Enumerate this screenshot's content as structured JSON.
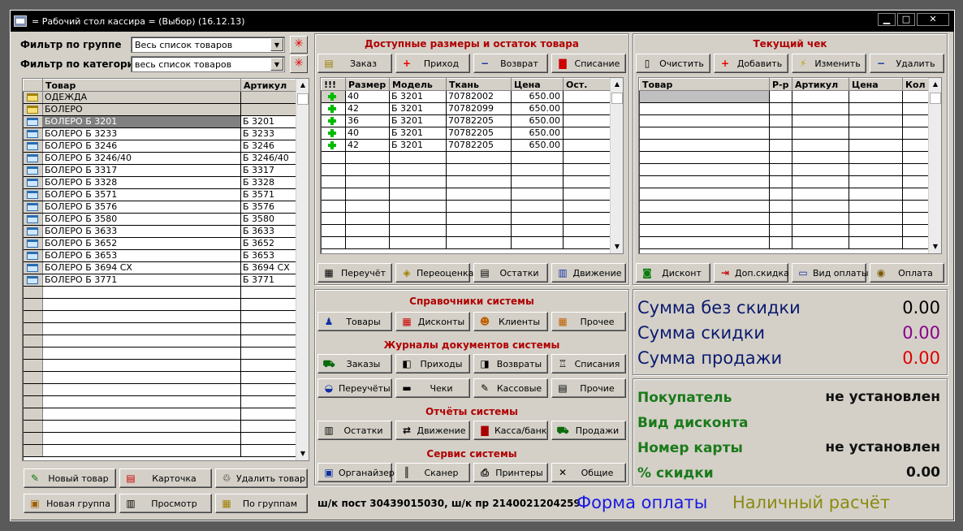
{
  "window": {
    "title": "= Рабочий стол кассира = (Выбор) (16.12.13)",
    "min": "▁",
    "max": "□",
    "close": "✕"
  },
  "filters": {
    "group_label": "Фильтр по группе",
    "group_value": "Весь список товаров",
    "category_label": "Фильтр по категории",
    "category_value": "весь список товаров"
  },
  "goods": {
    "headers": [
      "Товар",
      "Артикул"
    ],
    "rows": [
      {
        "name": "ОДЕЖДА",
        "art": "",
        "folder": "yellow"
      },
      {
        "name": "БОЛЕРО",
        "art": "",
        "folder": "yellow"
      },
      {
        "name": "БОЛЕРО Б 3201",
        "art": "Б 3201",
        "folder": "blue"
      },
      {
        "name": "БОЛЕРО Б 3233",
        "art": "Б 3233",
        "folder": "blue"
      },
      {
        "name": "БОЛЕРО Б 3246",
        "art": "Б 3246",
        "folder": "blue"
      },
      {
        "name": "БОЛЕРО Б 3246/40",
        "art": "Б 3246/40",
        "folder": "blue"
      },
      {
        "name": "БОЛЕРО Б 3317",
        "art": "Б 3317",
        "folder": "blue"
      },
      {
        "name": "БОЛЕРО Б 3328",
        "art": "Б 3328",
        "folder": "blue"
      },
      {
        "name": "БОЛЕРО Б 3571",
        "art": "Б 3571",
        "folder": "blue"
      },
      {
        "name": "БОЛЕРО Б 3576",
        "art": "Б 3576",
        "folder": "blue"
      },
      {
        "name": "БОЛЕРО Б 3580",
        "art": "Б 3580",
        "folder": "blue"
      },
      {
        "name": "БОЛЕРО Б 3633",
        "art": "Б 3633",
        "folder": "blue"
      },
      {
        "name": "БОЛЕРО Б 3652",
        "art": "Б 3652",
        "folder": "blue"
      },
      {
        "name": "БОЛЕРО Б 3653",
        "art": "Б 3653",
        "folder": "blue"
      },
      {
        "name": "БОЛЕРО Б 3694 СХ",
        "art": "Б 3694 СХ",
        "folder": "blue"
      },
      {
        "name": "БОЛЕРО Б 3771",
        "art": "Б 3771",
        "folder": "blue"
      }
    ],
    "selected_index": 2
  },
  "left_buttons": {
    "new_item": "Новый товар",
    "card": "Карточка",
    "delete_item": "Удалить товар",
    "new_group": "Новая группа",
    "view": "Просмотр",
    "by_groups": "По группам"
  },
  "sizes": {
    "title": "Доступные размеры и остаток товара",
    "buttons": [
      "Заказ",
      "Приход",
      "Возврат",
      "Списание"
    ],
    "headers": [
      "!!!",
      "Размер",
      "Модель",
      "Ткань",
      "Цена",
      "Ост."
    ],
    "rows": [
      {
        "size": "40",
        "model": "Б 3201",
        "fabric": "70782002",
        "price": "650.00",
        "rest": ""
      },
      {
        "size": "42",
        "model": "Б 3201",
        "fabric": "70782099",
        "price": "650.00",
        "rest": ""
      },
      {
        "size": "36",
        "model": "Б 3201",
        "fabric": "70782205",
        "price": "650.00",
        "rest": ""
      },
      {
        "size": "40",
        "model": "Б 3201",
        "fabric": "70782205",
        "price": "650.00",
        "rest": ""
      },
      {
        "size": "42",
        "model": "Б 3201",
        "fabric": "70782205",
        "price": "650.00",
        "rest": ""
      }
    ],
    "bottom_buttons": [
      "Переучёт",
      "Переоценка",
      "Остатки",
      "Движение"
    ]
  },
  "receipt": {
    "title": "Текущий чек",
    "buttons": [
      "Очистить",
      "Добавить",
      "Изменить",
      "Удалить"
    ],
    "headers": [
      "Товар",
      "Р-р",
      "Артикул",
      "Цена",
      "Кол"
    ],
    "bottom_buttons": [
      "Дисконт",
      "Доп.скидка",
      "Вид оплаты",
      "Оплата"
    ]
  },
  "system": {
    "refs_title": "Справочники системы",
    "refs": [
      "Товары",
      "Дисконты",
      "Клиенты",
      "Прочее"
    ],
    "journals_title": "Журналы документов системы",
    "journals1": [
      "Заказы",
      "Приходы",
      "Возвраты",
      "Списания"
    ],
    "journals2": [
      "Переучёты",
      "Чеки",
      "Кассовые",
      "Прочие"
    ],
    "reports_title": "Отчёты системы",
    "reports": [
      "Остатки",
      "Движение",
      "Касса/банк",
      "Продажи"
    ],
    "service_title": "Сервис системы",
    "service": [
      "Органайзер",
      "Сканер",
      "Принтеры",
      "Общие"
    ]
  },
  "sums": {
    "no_discount_label": "Сумма без скидки",
    "no_discount_value": "0.00",
    "discount_label": "Сумма скидки",
    "discount_value": "0.00",
    "sale_label": "Сумма продажи",
    "sale_value": "0.00",
    "colors": {
      "label": "#0b1a6e",
      "no_discount": "#000000",
      "discount": "#8a008a",
      "sale": "#e00000"
    }
  },
  "customer": {
    "buyer_label": "Покупатель",
    "buyer_value": "не установлен",
    "discount_kind_label": "Вид дисконта",
    "card_label": "Номер карты",
    "card_value": "не установлен",
    "percent_label": "% скидки",
    "percent_value": "0.00"
  },
  "status": {
    "barcodes": "ш/к пост 30439015030, ш/к пр 2140021204259",
    "payment_label": "Форма оплаты",
    "payment_value": "Наличный расчёт"
  }
}
